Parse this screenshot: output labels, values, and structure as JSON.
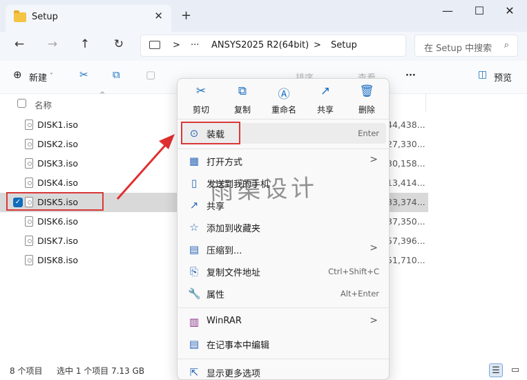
{
  "window": {
    "tab_title": "Setup",
    "tab_close": "✕",
    "new_tab": "+",
    "minimize": "—",
    "maximize": "☐",
    "close": "✕"
  },
  "nav": {
    "back": "←",
    "forward": "→",
    "up": "↑",
    "refresh": "↻",
    "chevron1": ">",
    "ellipsis": "···",
    "crumb1": "ANSYS2025 R2(64bit)",
    "chevron2": ">",
    "crumb2": "Setup",
    "search_placeholder": "在 Setup 中搜索"
  },
  "toolbar": {
    "new_label": "新建",
    "new_caret": "˅",
    "sort_label": "排序",
    "view_label": "查看",
    "more": "···",
    "preview_label": "预览"
  },
  "columns": {
    "name": "名称"
  },
  "files": [
    {
      "name": "DISK1.iso",
      "size": "44,438..."
    },
    {
      "name": "DISK2.iso",
      "size": "27,330..."
    },
    {
      "name": "DISK3.iso",
      "size": "30,158..."
    },
    {
      "name": "DISK4.iso",
      "size": "13,414..."
    },
    {
      "name": "DISK5.iso",
      "size": "33,374..."
    },
    {
      "name": "DISK6.iso",
      "size": "37,350..."
    },
    {
      "name": "DISK7.iso",
      "size": "57,396..."
    },
    {
      "name": "DISK8.iso",
      "size": "51,710..."
    }
  ],
  "selected_index": 4,
  "status": {
    "count": "8 个项目",
    "selected": "选中 1 个项目  7.13 GB"
  },
  "context_menu": {
    "quick_actions": [
      {
        "label": "剪切",
        "icon": "cut-icon",
        "glyph": "✂"
      },
      {
        "label": "复制",
        "icon": "copy-icon",
        "glyph": "⧉"
      },
      {
        "label": "重命名",
        "icon": "rename-icon",
        "glyph": "Ⓐ"
      },
      {
        "label": "共享",
        "icon": "share-icon",
        "glyph": "↗"
      },
      {
        "label": "删除",
        "icon": "delete-icon",
        "glyph": "🗑"
      }
    ],
    "items": [
      {
        "label": "装载",
        "key": "Enter",
        "icon": "mount-icon",
        "glyph": "⊙"
      },
      {
        "label": "打开方式",
        "icon": "open-with-icon",
        "glyph": "▦",
        "submenu": true
      },
      {
        "label": "发送到我的手机",
        "icon": "phone-icon",
        "glyph": "▯"
      },
      {
        "label": "共享",
        "icon": "share-icon",
        "glyph": "↗"
      },
      {
        "label": "添加到收藏夹",
        "icon": "star-icon",
        "glyph": "☆"
      },
      {
        "label": "压缩到...",
        "icon": "zip-folder-icon",
        "glyph": "▤",
        "submenu": true
      },
      {
        "label": "复制文件地址",
        "key": "Ctrl+Shift+C",
        "icon": "copy-path-icon",
        "glyph": "⎘"
      },
      {
        "label": "属性",
        "key": "Alt+Enter",
        "icon": "wrench-icon",
        "glyph": "🔧"
      },
      {
        "label": "WinRAR",
        "icon": "winrar-icon",
        "glyph": "▥",
        "submenu": true
      },
      {
        "label": "在记事本中编辑",
        "icon": "notepad-icon",
        "glyph": "▤"
      },
      {
        "label": "显示更多选项",
        "icon": "more-options-icon",
        "glyph": "⇱"
      }
    ],
    "submenu_arrow": ">"
  },
  "watermark": "雨渠设计",
  "colors": {
    "accent": "#0f6cbd",
    "highlight_box": "#d93838"
  }
}
